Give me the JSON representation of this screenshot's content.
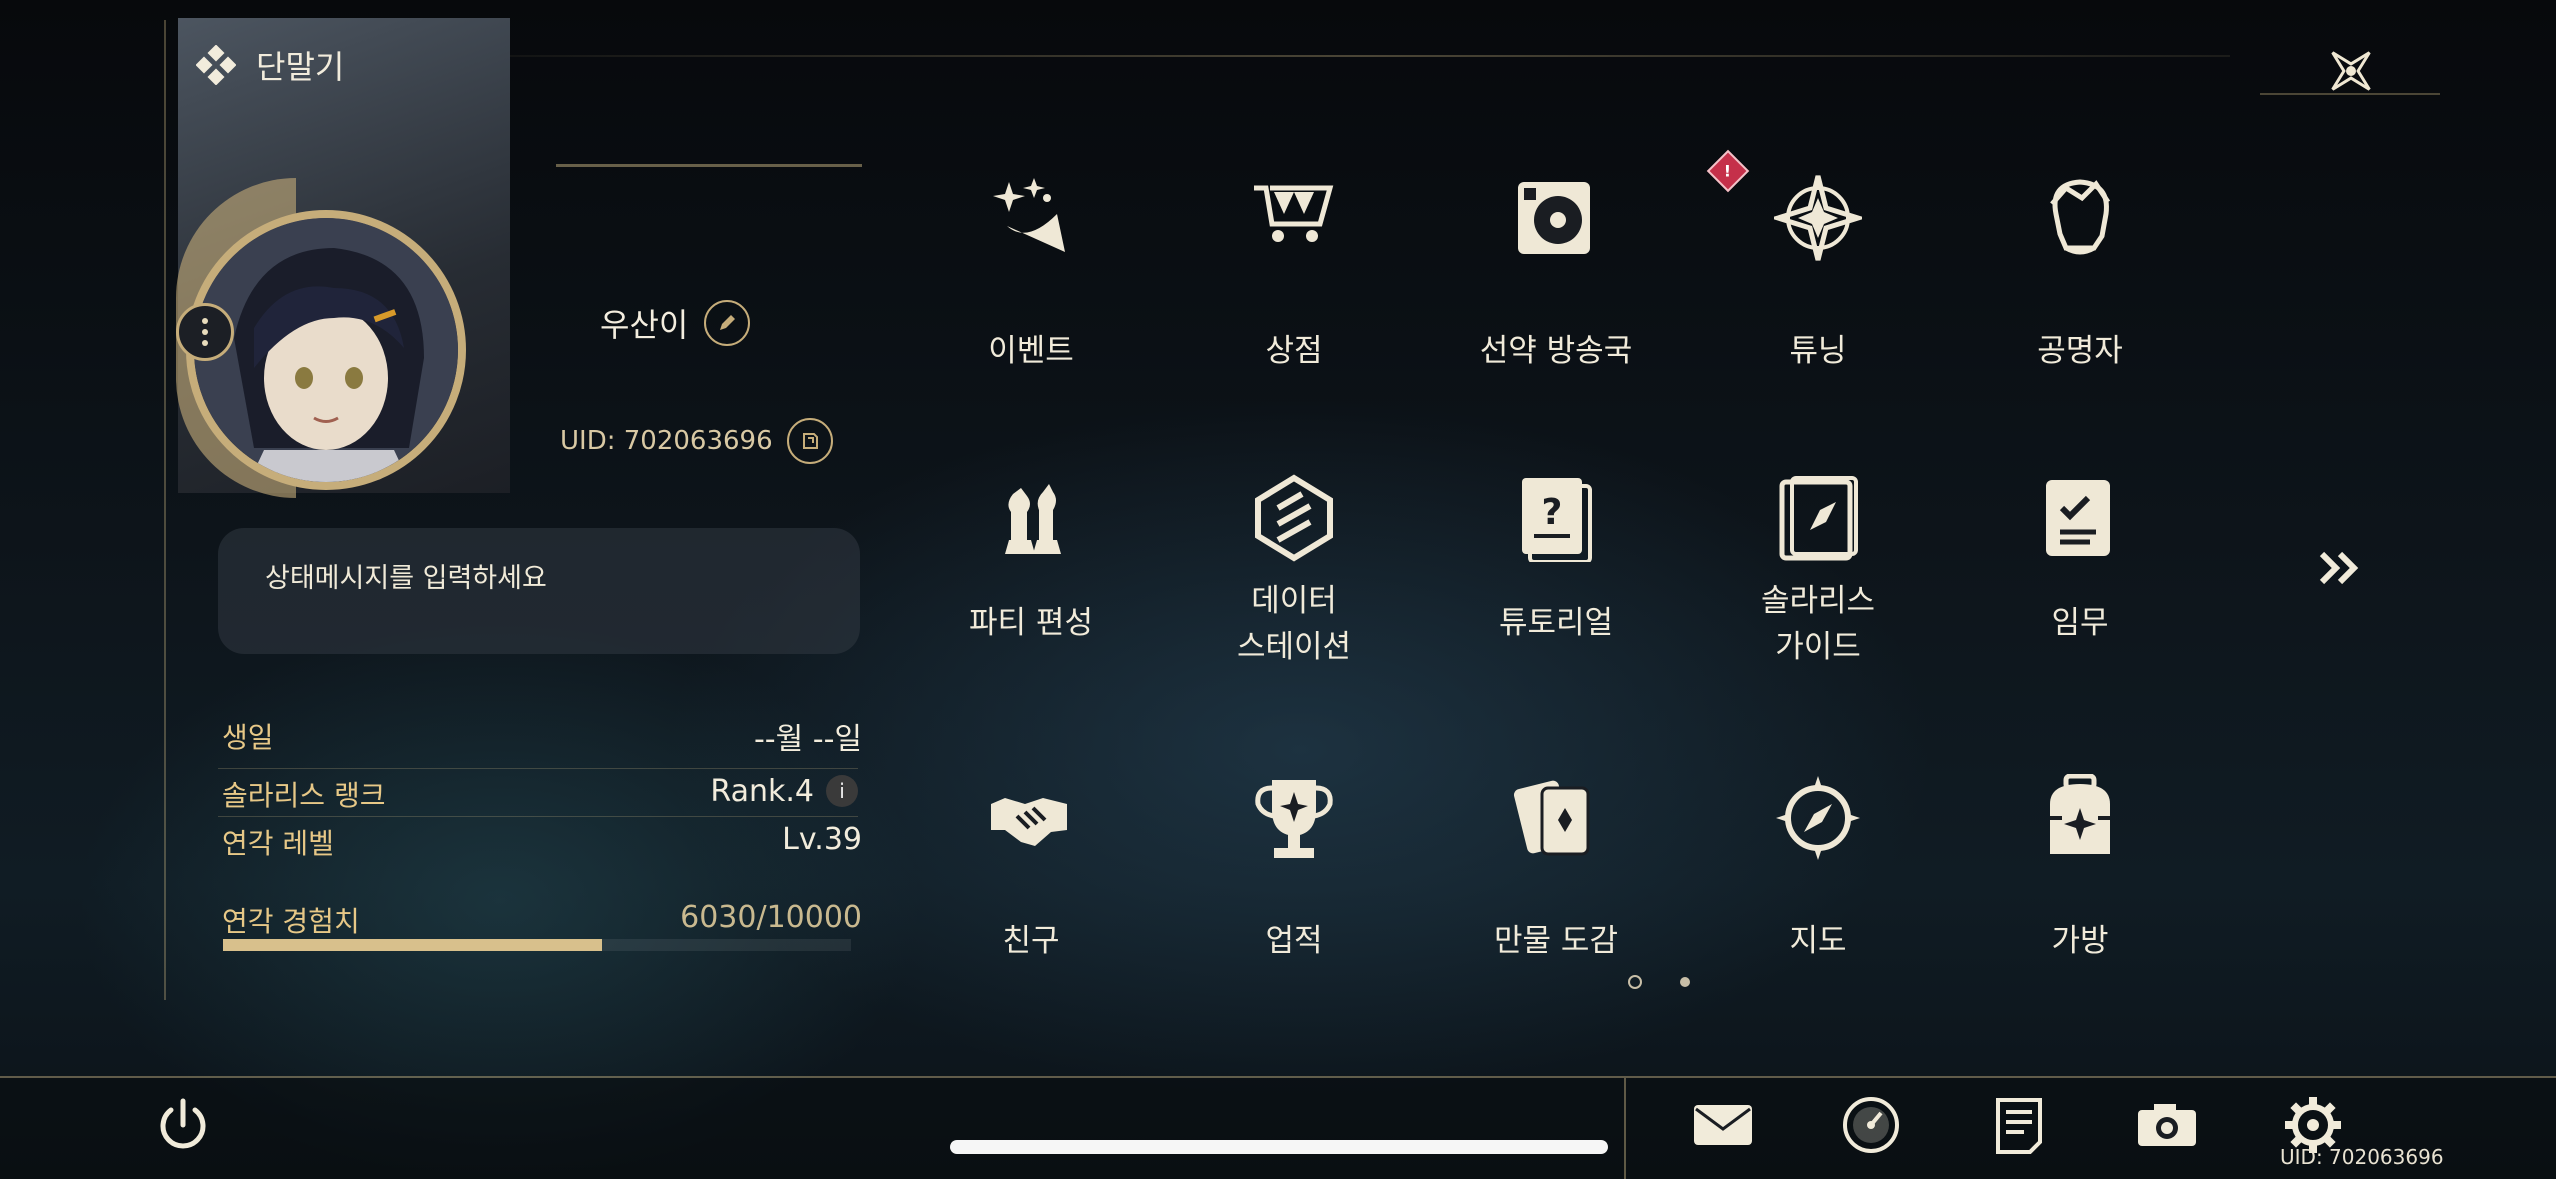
{
  "header": {
    "title": "단말기"
  },
  "profile": {
    "username": "우산이",
    "uid": "UID: 702063696",
    "status_placeholder": "상태메시지를 입력하세요"
  },
  "stats": {
    "birthday_label": "생일",
    "birthday_value": "--월 --일",
    "rank_label": "솔라리스 랭크",
    "rank_value": "Rank.4",
    "level_label": "연각 레벨",
    "level_value": "Lv.39",
    "exp_label": "연각 경험치",
    "exp_value": "6030/10000",
    "exp_fraction": 0.603
  },
  "menu": {
    "items": [
      {
        "label": "이벤트",
        "icon": "event-stars-icon"
      },
      {
        "label": "상점",
        "icon": "shop-cart-icon"
      },
      {
        "label": "선약 방송국",
        "icon": "radio-station-icon",
        "badge": "!"
      },
      {
        "label": "튜닝",
        "icon": "tuning-star-icon"
      },
      {
        "label": "공명자",
        "icon": "resonator-head-icon"
      },
      {
        "label": "파티 편성",
        "icon": "party-chess-icon"
      },
      {
        "label": "데이터\n스테이션",
        "icon": "data-station-icon"
      },
      {
        "label": "튜토리얼",
        "icon": "tutorial-book-icon"
      },
      {
        "label": "솔라리스\n가이드",
        "icon": "guide-compass-book-icon"
      },
      {
        "label": "임무",
        "icon": "quest-checklist-icon"
      },
      {
        "label": "친구",
        "icon": "handshake-icon"
      },
      {
        "label": "업적",
        "icon": "trophy-icon"
      },
      {
        "label": "만물 도감",
        "icon": "cards-icon"
      },
      {
        "label": "지도",
        "icon": "compass-icon"
      },
      {
        "label": "가방",
        "icon": "backpack-icon"
      }
    ]
  },
  "footer": {
    "uid": "UID: 702063696",
    "icons": [
      "mail-icon",
      "clock-icon",
      "notes-icon",
      "camera-icon",
      "settings-gear-icon"
    ]
  },
  "colors": {
    "accent_gold": "#c6ad7a",
    "badge_red": "#c5304a",
    "exp_fill": "#d8c08c"
  }
}
